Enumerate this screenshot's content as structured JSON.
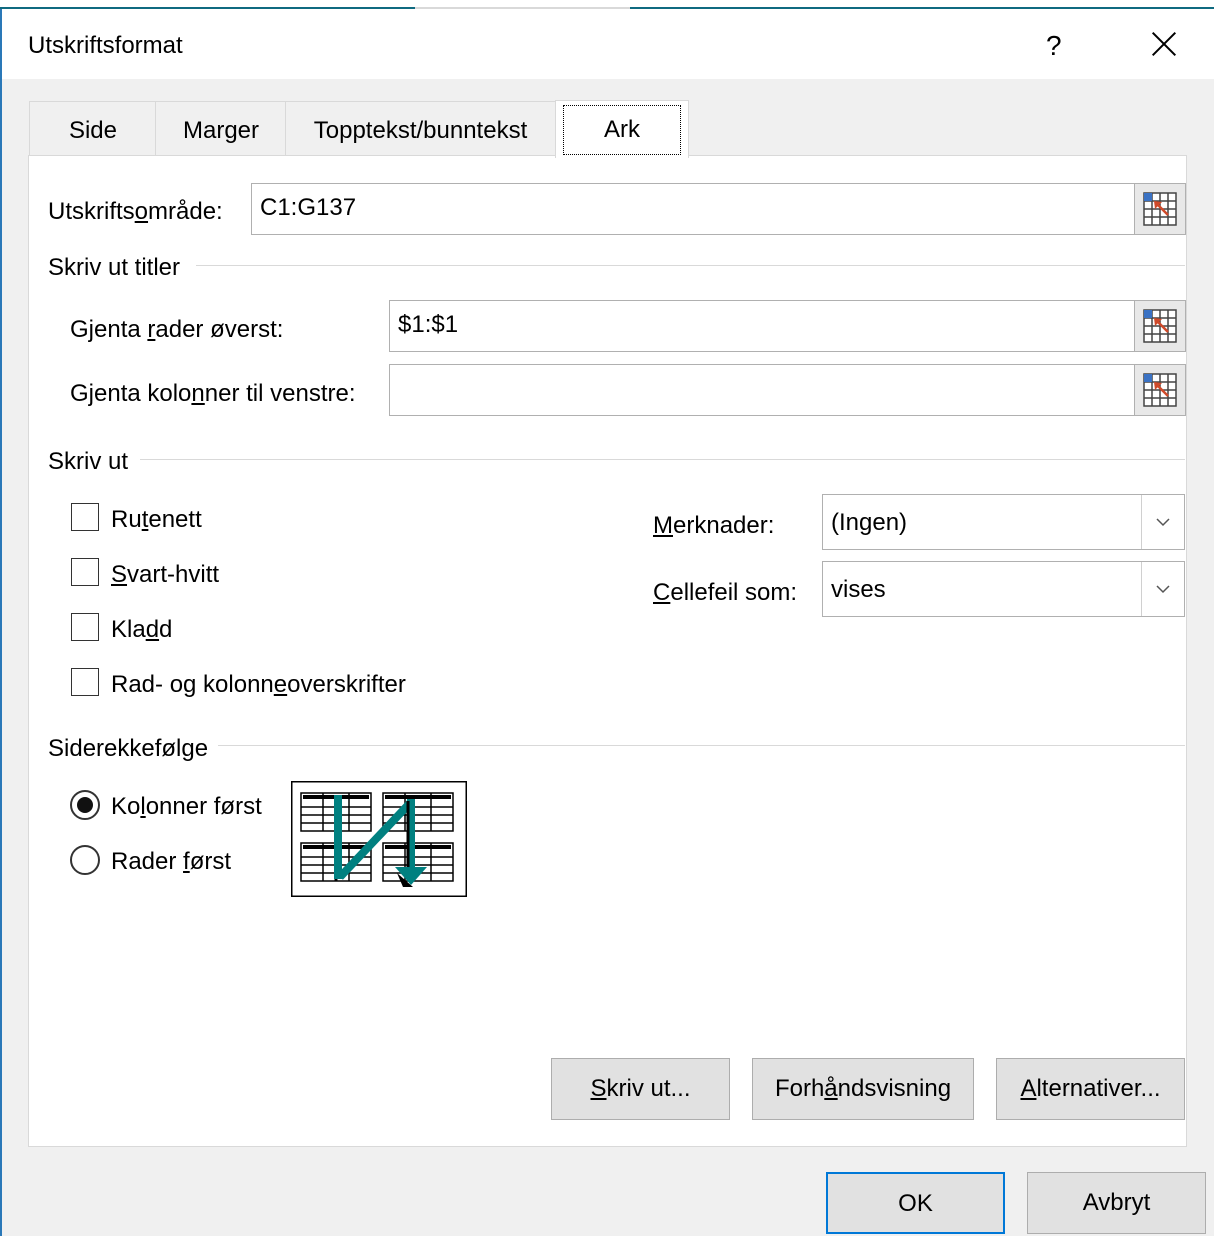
{
  "window": {
    "title": "Utskriftsformat",
    "help_label": "?"
  },
  "tabs": [
    {
      "label": "Side"
    },
    {
      "label": "Marger"
    },
    {
      "label": "Topptekst/bunntekst"
    },
    {
      "label": "Ark",
      "active": true
    }
  ],
  "print_area": {
    "label_pre": "Utskrifts",
    "label_u": "o",
    "label_post": "mråde:",
    "value": "C1:G137"
  },
  "print_titles": {
    "heading": "Skriv ut titler",
    "rows_label_pre": "Gjenta ",
    "rows_label_u": "r",
    "rows_label_post": "ader øverst:",
    "rows_value": "$1:$1",
    "cols_label_pre": "Gjenta kolo",
    "cols_label_u": "n",
    "cols_label_post": "ner til venstre:",
    "cols_value": ""
  },
  "print": {
    "heading": "Skriv ut",
    "checkboxes": [
      {
        "pre": "Ru",
        "u": "t",
        "post": "enett",
        "checked": false
      },
      {
        "pre": "",
        "u": "S",
        "post": "vart-hvitt",
        "checked": false
      },
      {
        "pre": "Kla",
        "u": "d",
        "post": "d",
        "checked": false
      },
      {
        "pre": "Rad- og kolonn",
        "u": "e",
        "post": "overskrifter",
        "checked": false
      }
    ],
    "comments_label_u": "M",
    "comments_label_post": "erknader:",
    "comments_value": "(Ingen)",
    "errors_label_u": "C",
    "errors_label_post": "ellefeil som:",
    "errors_value": "vises"
  },
  "page_order": {
    "heading": "Siderekkefølge",
    "options": [
      {
        "pre": "Ko",
        "u": "l",
        "post": "onner først",
        "selected": true
      },
      {
        "pre": "Rader ",
        "u": "f",
        "post": "ørst",
        "selected": false
      }
    ]
  },
  "buttons": {
    "print_u": "S",
    "print_post": "kriv ut...",
    "preview_pre": "Forh",
    "preview_u": "å",
    "preview_post": "ndsvisning",
    "options_u": "A",
    "options_post": "lternativer...",
    "ok": "OK",
    "cancel": "Avbryt"
  },
  "colors": {
    "accent": "#0078d7",
    "arrow_teal": "#008080",
    "ref_red": "#d04a2a"
  }
}
